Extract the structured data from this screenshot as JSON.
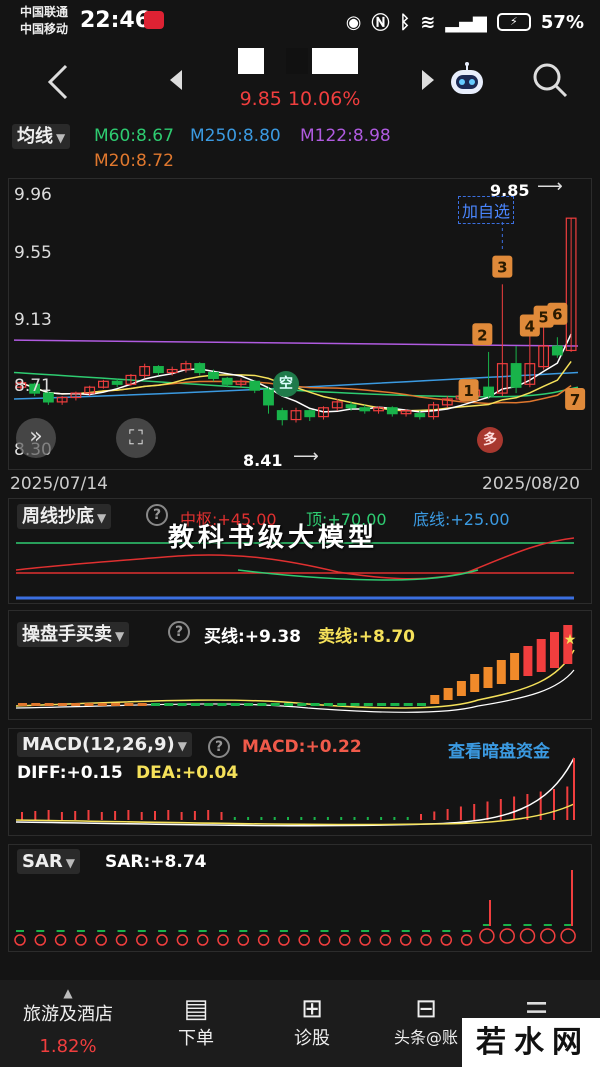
{
  "status_bar": {
    "carrier1": "中国联通",
    "carrier2": "中国移动",
    "time": "22:46",
    "battery": "57%"
  },
  "header": {
    "price_change": "9.85 10.06%"
  },
  "ma_legend": {
    "dropdown": "均线",
    "m60": "M60:8.67",
    "m250": "M250:8.80",
    "m122": "M122:8.98",
    "m20": "M20:8.72",
    "colors": {
      "m60": "#2ecc71",
      "m250": "#3b9ae1",
      "m122": "#b05be0",
      "m20": "#e0782e"
    }
  },
  "chart_data": [
    {
      "type": "candlestick",
      "y_ticks": [
        "9.96",
        "9.55",
        "9.13",
        "8.71",
        "8.30"
      ],
      "x_labels": [
        "2025/07/14",
        "2025/08/20"
      ],
      "high_annotation": "9.85",
      "low_annotation": "8.41",
      "add_watchlist": "加自选",
      "tag_short": "空",
      "tag_long": "多",
      "step_markers": [
        "1",
        "2",
        "3",
        "4",
        "5",
        "6",
        "7"
      ],
      "candles": [
        [
          8.7,
          8.73,
          8.68,
          8.74
        ],
        [
          8.72,
          8.66,
          8.64,
          8.73
        ],
        [
          8.66,
          8.6,
          8.58,
          8.67
        ],
        [
          8.6,
          8.63,
          8.58,
          8.64
        ],
        [
          8.63,
          8.66,
          8.61,
          8.67
        ],
        [
          8.66,
          8.7,
          8.64,
          8.71
        ],
        [
          8.7,
          8.74,
          8.69,
          8.75
        ],
        [
          8.74,
          8.72,
          8.7,
          8.76
        ],
        [
          8.72,
          8.78,
          8.71,
          8.79
        ],
        [
          8.78,
          8.84,
          8.76,
          8.86
        ],
        [
          8.84,
          8.8,
          8.78,
          8.85
        ],
        [
          8.8,
          8.82,
          8.78,
          8.84
        ],
        [
          8.82,
          8.86,
          8.8,
          8.88
        ],
        [
          8.86,
          8.8,
          8.78,
          8.87
        ],
        [
          8.8,
          8.76,
          8.74,
          8.82
        ],
        [
          8.76,
          8.72,
          8.7,
          8.77
        ],
        [
          8.72,
          8.74,
          8.7,
          8.76
        ],
        [
          8.74,
          8.68,
          8.66,
          8.75
        ],
        [
          8.68,
          8.58,
          8.52,
          8.7
        ],
        [
          8.54,
          8.48,
          8.44,
          8.56
        ],
        [
          8.48,
          8.54,
          8.46,
          8.56
        ],
        [
          8.54,
          8.5,
          8.47,
          8.55
        ],
        [
          8.5,
          8.56,
          8.48,
          8.57
        ],
        [
          8.56,
          8.6,
          8.54,
          8.62
        ],
        [
          8.58,
          8.56,
          8.54,
          8.6
        ],
        [
          8.56,
          8.54,
          8.52,
          8.58
        ],
        [
          8.54,
          8.56,
          8.52,
          8.57
        ],
        [
          8.56,
          8.52,
          8.5,
          8.57
        ],
        [
          8.52,
          8.54,
          8.5,
          8.55
        ],
        [
          8.52,
          8.5,
          8.48,
          8.54
        ],
        [
          8.5,
          8.58,
          8.48,
          8.6
        ],
        [
          8.58,
          8.62,
          8.56,
          8.64
        ],
        [
          8.62,
          8.64,
          8.6,
          8.66
        ],
        [
          8.64,
          8.68,
          8.62,
          8.72
        ],
        [
          8.7,
          8.64,
          8.62,
          8.94
        ],
        [
          8.66,
          8.86,
          8.64,
          9.4
        ],
        [
          8.86,
          8.7,
          8.66,
          8.98
        ],
        [
          8.72,
          8.86,
          8.7,
          9.08
        ],
        [
          8.84,
          8.98,
          8.82,
          9.12
        ],
        [
          8.98,
          8.92,
          8.9,
          9.04
        ],
        [
          8.95,
          9.85,
          8.94,
          9.85
        ]
      ]
    },
    {
      "type": "line",
      "title": "周线抄底",
      "values_label": {
        "mid": "中枢:+45.00",
        "top": "顶:+70.00",
        "bottom": "底线:+25.00"
      }
    },
    {
      "type": "bar",
      "title": "操盘手买卖",
      "buy": "买线:+9.38",
      "sell": "卖线:+8.70"
    },
    {
      "type": "bar",
      "title": "MACD(12,26,9)",
      "macd": "MACD:+0.22",
      "diff": "DIFF:+0.15",
      "dea": "DEA:+0.04",
      "link": "查看暗盘资金"
    },
    {
      "type": "scatter",
      "title": "SAR",
      "value": "SAR:+8.74"
    }
  ],
  "overlay": {
    "watermark": "教科书级大模型"
  },
  "bottom_nav": {
    "industry": "旅游及酒店",
    "industry_change": "1.82%",
    "order": "下单",
    "diagnose": "诊股",
    "item4": "头条",
    "footer_credit": "@账",
    "logo": "若水网"
  }
}
